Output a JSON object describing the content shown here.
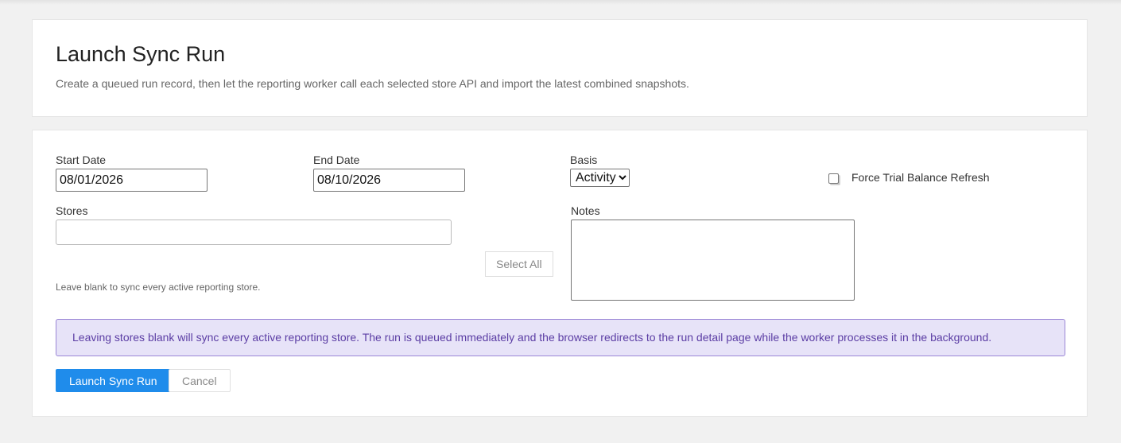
{
  "header": {
    "title": "Launch Sync Run",
    "subtitle": "Create a queued run record, then let the reporting worker call each selected store API and import the latest combined snapshots."
  },
  "form": {
    "start_date": {
      "label": "Start Date",
      "value": "08/01/2026"
    },
    "end_date": {
      "label": "End Date",
      "value": "08/10/2026"
    },
    "basis": {
      "label": "Basis",
      "selected": "Activity"
    },
    "force_refresh": {
      "label": "Force Trial Balance Refresh",
      "checked": false
    },
    "stores": {
      "label": "Stores",
      "value": "",
      "select_all_label": "Select All",
      "hint": "Leave blank to sync every active reporting store."
    },
    "notes": {
      "label": "Notes",
      "value": ""
    },
    "alert": "Leaving stores blank will sync every active reporting store. The run is queued immediately and the browser redirects to the run detail page while the worker processes it in the background.",
    "submit_label": "Launch Sync Run",
    "cancel_label": "Cancel"
  },
  "colors": {
    "primary": "#1f8ceb",
    "alert_bg": "#e7e3f8",
    "alert_border": "#9a86d6",
    "alert_text": "#5b3da4"
  }
}
